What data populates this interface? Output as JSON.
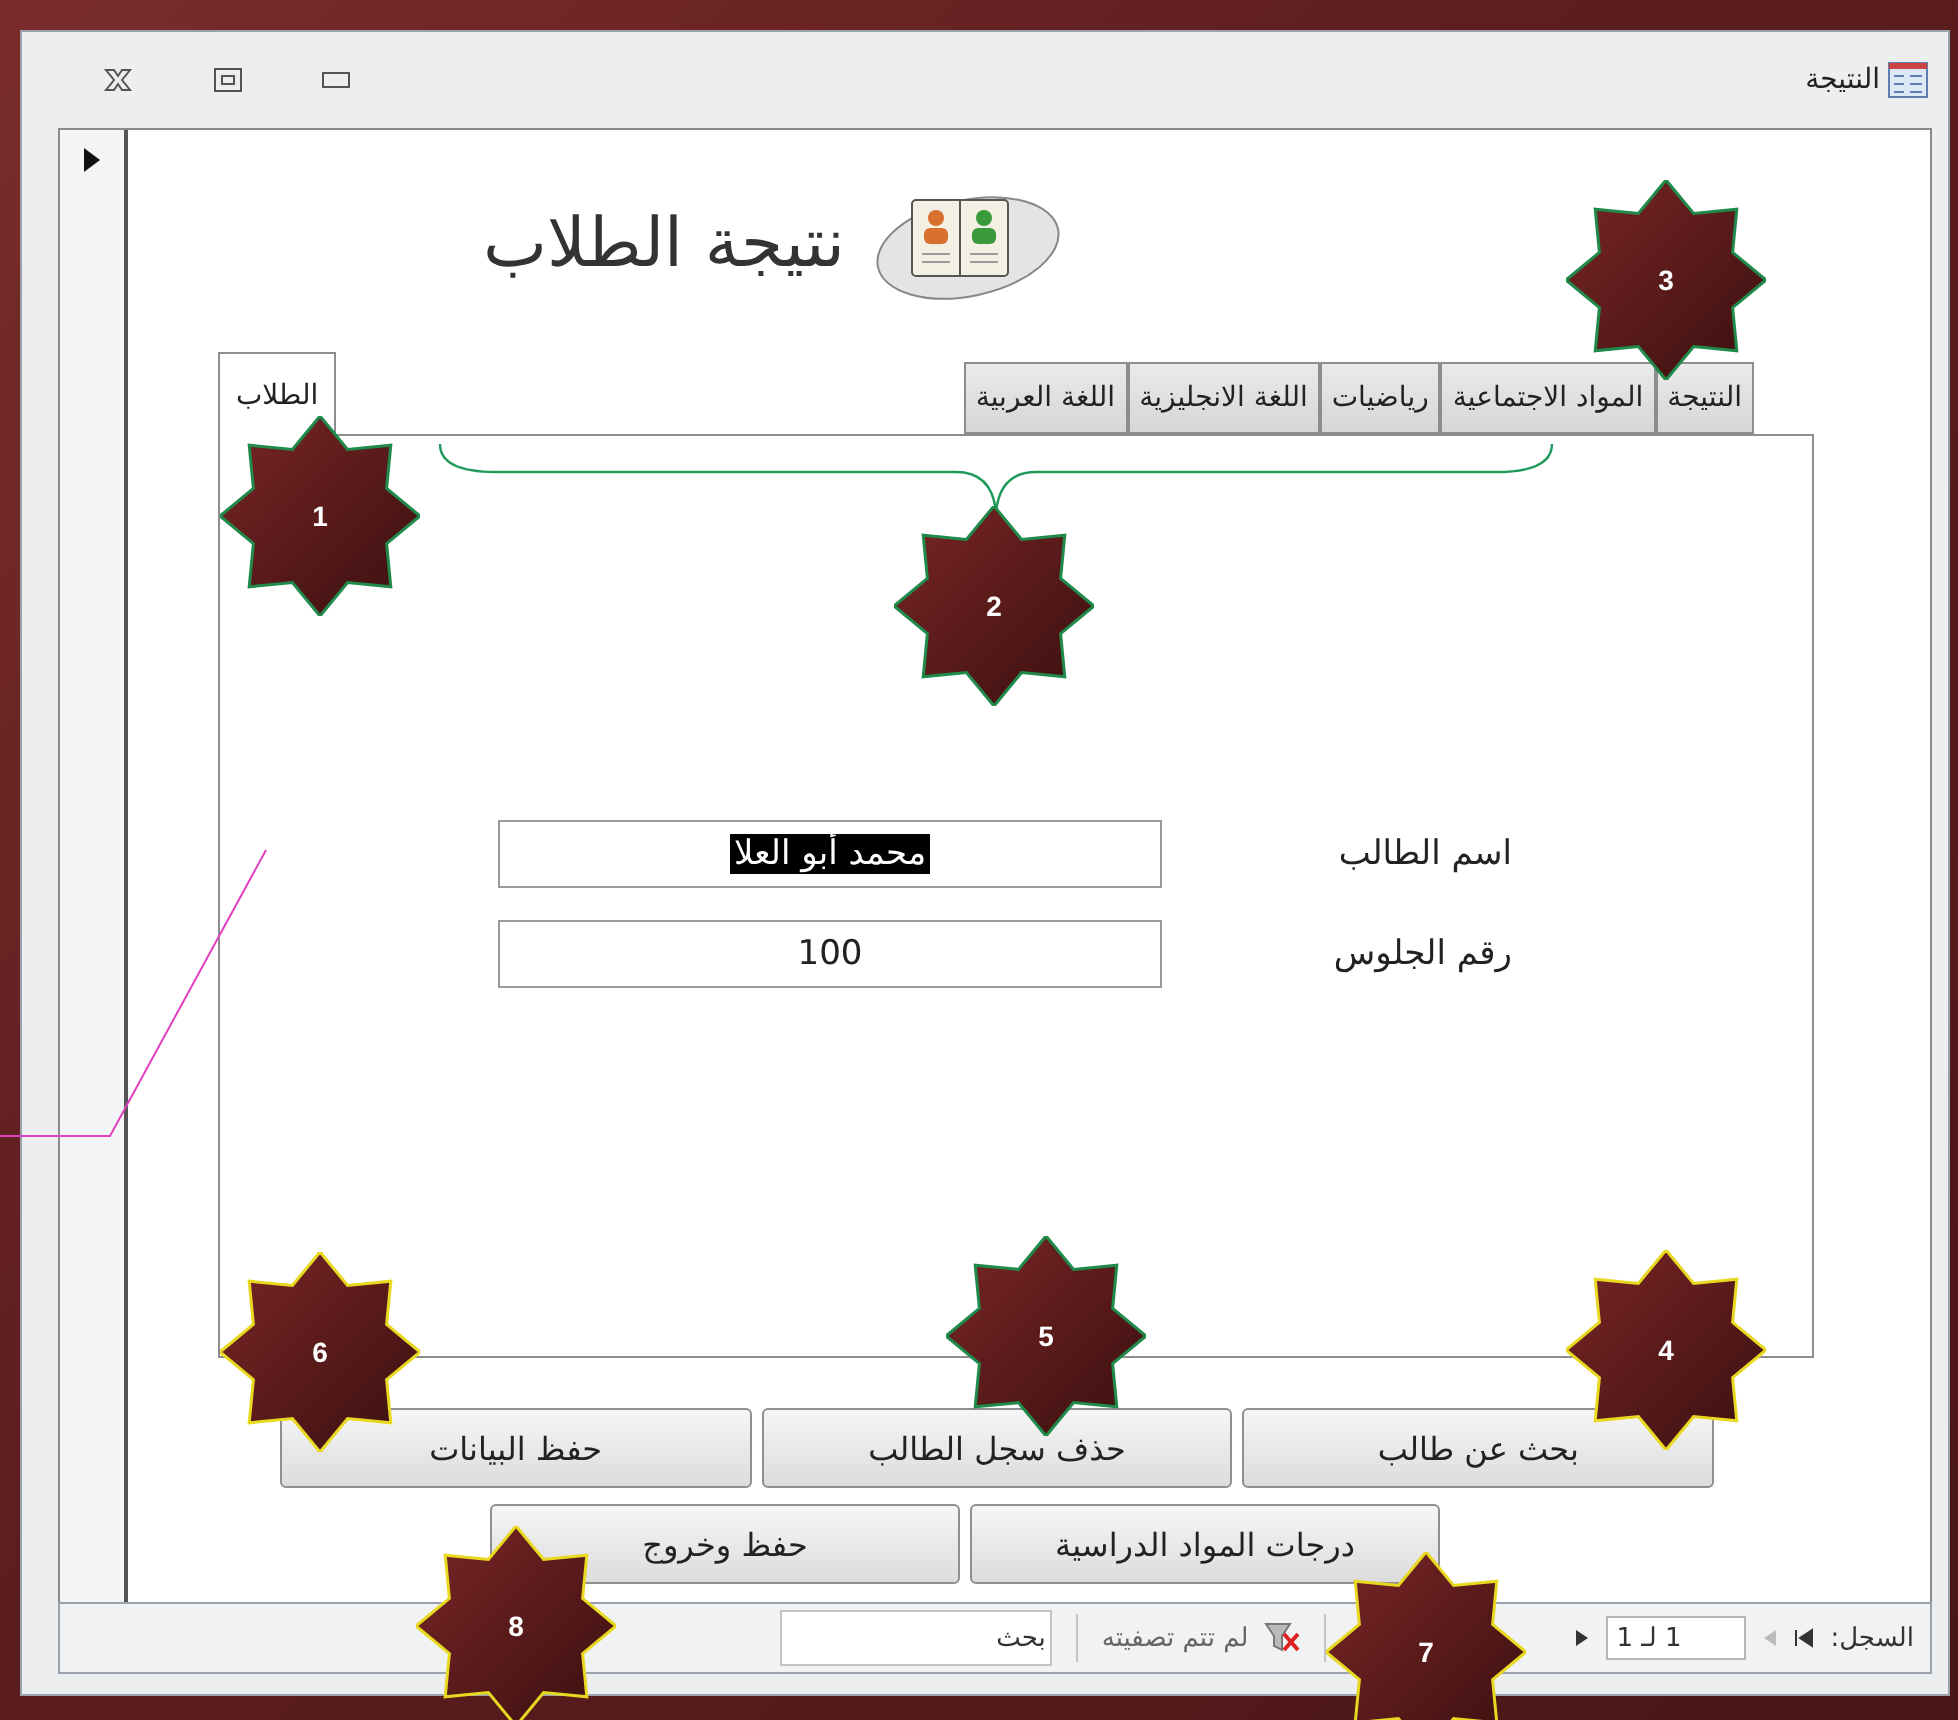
{
  "window": {
    "title": "النتيجة"
  },
  "form": {
    "heading": "نتيجة الطلاب",
    "tabs": [
      {
        "label": "النتيجة",
        "selected": false
      },
      {
        "label": "المواد الاجتماعية",
        "selected": false
      },
      {
        "label": "رياضيات",
        "selected": false
      },
      {
        "label": "اللغة الانجليزية",
        "selected": false
      },
      {
        "label": "اللغة العربية",
        "selected": false
      },
      {
        "label": "الطلاب",
        "selected": true
      }
    ],
    "fields": [
      {
        "label": "اسم الطالب",
        "value": "محمد أبو العلا",
        "highlighted": true
      },
      {
        "label": "رقم الجلوس",
        "value": "100",
        "highlighted": false
      }
    ],
    "button_rows": [
      {
        "buttons": [
          "بحث عن طالب",
          "حذف سجل الطالب",
          "حفظ البيانات"
        ]
      },
      {
        "buttons": [
          "درجات المواد الدراسية",
          "حفظ وخروج"
        ]
      }
    ]
  },
  "status_bar": {
    "record_label": "السجل:",
    "record_position": "1 لـ 1",
    "filter_status": "لم تتم تصفيته",
    "search_placeholder": "بحث"
  },
  "annotations": [
    {
      "number": "1",
      "color": "#1f8a4a"
    },
    {
      "number": "2",
      "color": "#1f8a4a"
    },
    {
      "number": "3",
      "color": "#1f8a4a"
    },
    {
      "number": "4",
      "color": "#e8d820"
    },
    {
      "number": "5",
      "color": "#1f8a4a"
    },
    {
      "number": "6",
      "color": "#e8d820"
    },
    {
      "number": "7",
      "color": "#e8d820"
    },
    {
      "number": "8",
      "color": "#e8d820"
    }
  ]
}
